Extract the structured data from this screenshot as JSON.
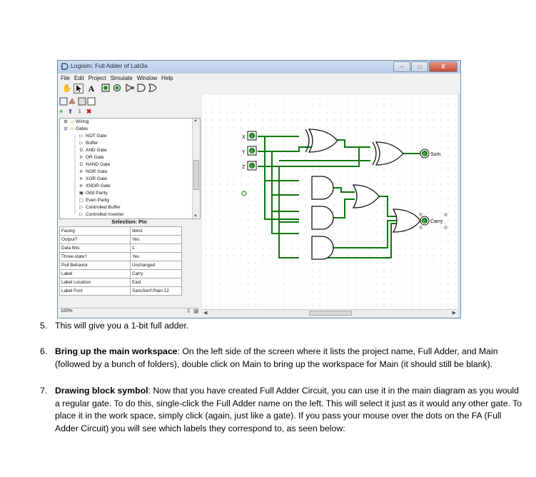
{
  "window": {
    "title": "Logisim: Full Adder of Lab3a",
    "buttons": {
      "minimize": "–",
      "maximize": "□",
      "close": "X"
    },
    "menu": [
      "File",
      "Edit",
      "Project",
      "Simulate",
      "Window",
      "Help"
    ],
    "toolbar_tools": [
      "poke-icon",
      "select-icon",
      "text-icon",
      "input-pin-icon",
      "output-pin-icon",
      "not-gate-icon",
      "and-gate-icon",
      "or-gate-icon"
    ],
    "tree": {
      "groups": [
        {
          "label": "Wiring",
          "expanded": false
        },
        {
          "label": "Gates",
          "expanded": true
        }
      ],
      "items": [
        "NOT Gate",
        "Buffer",
        "AND Gate",
        "OR Gate",
        "NAND Gate",
        "NOR Gate",
        "XOR Gate",
        "XNOR Gate",
        "Odd Parity",
        "Even Parity",
        "Controlled Buffer",
        "Controlled Inverter"
      ]
    },
    "selection_title": "Selection: Pin",
    "attributes": [
      {
        "key": "Facing",
        "value": "West"
      },
      {
        "key": "Output?",
        "value": "Yes"
      },
      {
        "key": "Data Bits",
        "value": "1"
      },
      {
        "key": "Three-state?",
        "value": "Yes"
      },
      {
        "key": "Pull Behavior",
        "value": "Unchanged"
      },
      {
        "key": "Label",
        "value": "Carry"
      },
      {
        "key": "Label Location",
        "value": "East"
      },
      {
        "key": "Label Font",
        "value": "SansSerif Plain 12"
      }
    ],
    "zoom": "100%",
    "circuit": {
      "inputs": [
        {
          "label": "X",
          "value": "0"
        },
        {
          "label": "Y",
          "value": "0"
        },
        {
          "label": "Z",
          "value": "0"
        }
      ],
      "outputs": [
        {
          "label": "Sum",
          "value": "0"
        },
        {
          "label": "Carry",
          "value": "0"
        }
      ],
      "wire_color": "#0a7a0a"
    }
  },
  "document": {
    "item5": {
      "num": "5.",
      "text": "This will give you a 1-bit full adder."
    },
    "item6": {
      "num": "6.",
      "bold": "Bring up the main workspace",
      "text": ": On the left side of the screen where it lists the project name, Full Adder, and Main (followed by a bunch of folders), double click on Main to bring up the workspace for Main (it should still be blank)."
    },
    "item7": {
      "num": "7.",
      "bold": "Drawing block symbol",
      "text": ": Now that you have created Full Adder Circuit, you can use it in the main diagram as you would a regular gate.  To do this, single-click the Full Adder name on the left.  This will select it just as it would any other gate.  To place it in the work space, simply click (again, just like a gate).  If you pass your mouse over the dots on the FA (Full Adder Circuit) you will see which labels they correspond to, as seen below:"
    }
  }
}
